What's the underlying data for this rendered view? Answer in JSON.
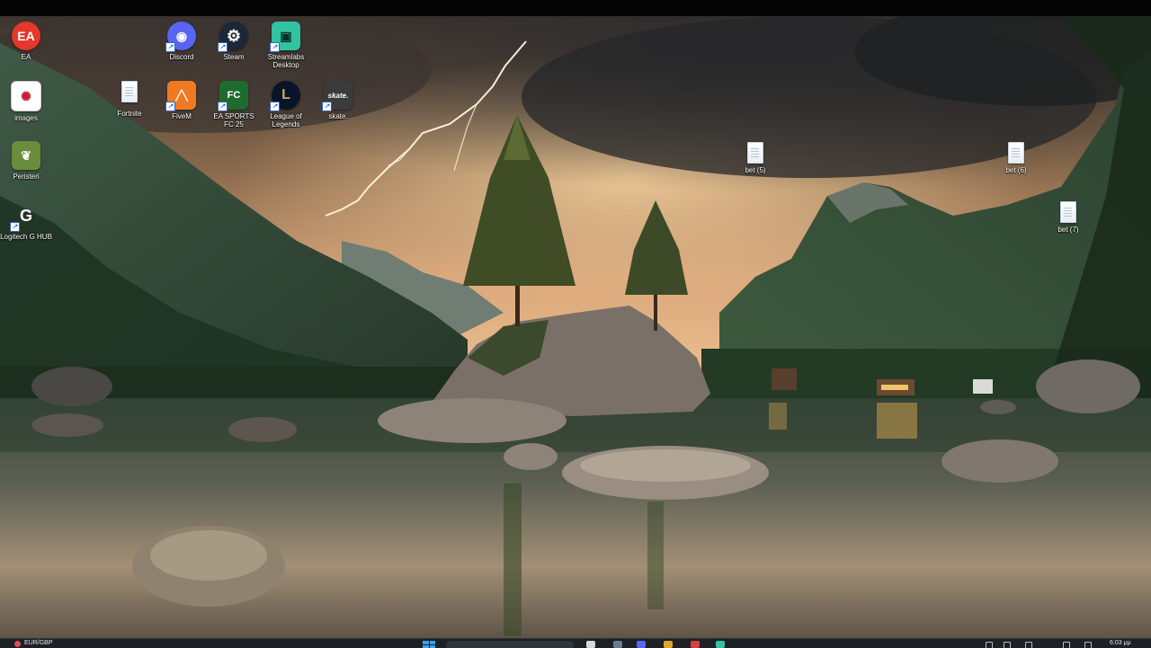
{
  "desktop": {
    "icons": [
      {
        "label": "EA",
        "icon": "ea-icon"
      },
      {
        "label": "images",
        "icon": "images-icon"
      },
      {
        "label": "Peristeri",
        "icon": "peristeri-icon"
      },
      {
        "label": "Logitech G HUB",
        "icon": "logitech-g-hub-icon"
      },
      {
        "label": "Fortnite",
        "icon": "fortnite-icon"
      },
      {
        "label": "Discord",
        "icon": "discord-icon"
      },
      {
        "label": "FiveM",
        "icon": "fivem-icon"
      },
      {
        "label": "Steam",
        "icon": "steam-icon"
      },
      {
        "label": "EA SPORTS FC 25",
        "icon": "ea-sports-fc-icon"
      },
      {
        "label": "Streamlabs Desktop",
        "icon": "streamlabs-icon"
      },
      {
        "label": "League of Legends",
        "icon": "league-of-legends-icon"
      },
      {
        "label": "skate.",
        "icon": "skate-icon"
      },
      {
        "label": "bet (5)",
        "icon": "text-file-icon"
      },
      {
        "label": "bet (6)",
        "icon": "text-file-icon"
      },
      {
        "label": "bet (7)",
        "icon": "text-file-icon"
      }
    ],
    "glyphs": {
      "ea": "EA",
      "discord": "◉",
      "steam": "⚙",
      "streamlabs": "▣",
      "fivem": "╱╲",
      "fc": "FC",
      "lol": "L",
      "skate": "skate.",
      "logitech": "G",
      "images": "✺",
      "peristeri": "❦"
    }
  },
  "taskbar": {
    "widget_text": "EUR/GBP",
    "clock": "6:03 μμ"
  },
  "colors": {
    "ea": "#e5372a",
    "discord": "#5865f2",
    "steam": "#1b2838",
    "streamlabs": "#31c3a2",
    "fivem": "#f07a22",
    "fc": "#1e6b2e",
    "lol": "#0a1428",
    "skate": "#3b3b3b",
    "taskbar": "#1d2126"
  }
}
